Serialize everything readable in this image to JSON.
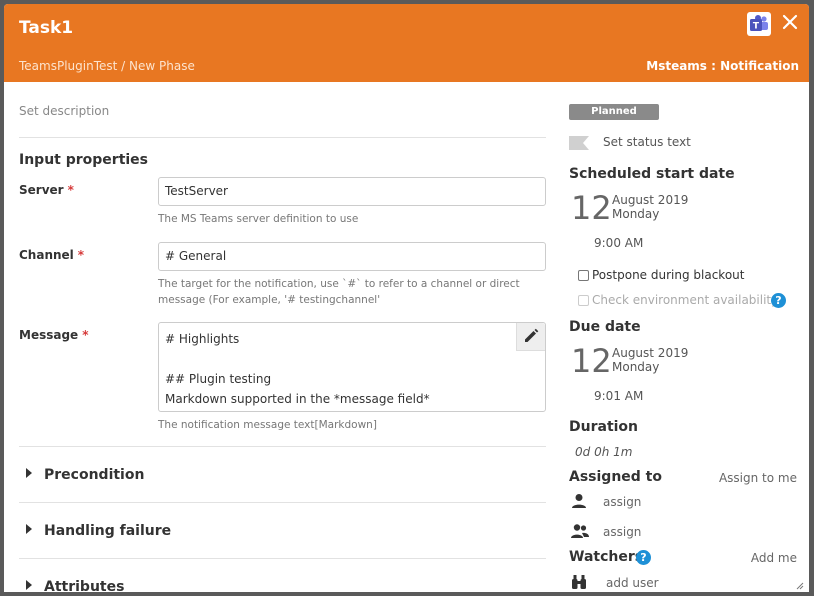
{
  "header": {
    "title": "Task1",
    "breadcrumb": "TeamsPluginTest / New Phase",
    "task_type": "Msteams : Notification",
    "color": "#e87722",
    "icons": [
      "teams-icon",
      "close-icon"
    ]
  },
  "left": {
    "description_placeholder": "Set description",
    "input_properties_title": "Input properties",
    "server": {
      "label": "Server",
      "required": "*",
      "value": "TestServer",
      "help": "The MS Teams server definition to use"
    },
    "channel": {
      "label": "Channel",
      "required": "*",
      "value": "# General",
      "help": "The target for the notification, use `#` to refer to a channel or direct message (For example, '# testingchannel'"
    },
    "message": {
      "label": "Message",
      "required": "*",
      "lines": [
        "# Highlights",
        "",
        "## Plugin testing",
        "Markdown supported in the *message field*"
      ],
      "help": "The notification message text[Markdown]"
    },
    "sections": [
      "Precondition",
      "Handling failure",
      "Attributes"
    ]
  },
  "right": {
    "status_badge": "Planned",
    "status_text_placeholder": "Set status text",
    "scheduled_start": {
      "title": "Scheduled start date",
      "day": "12",
      "month_year": "August 2019",
      "weekday": "Monday",
      "time": "9:00 AM"
    },
    "postpone_label": "Postpone during blackout",
    "check_env_label": "Check environment availability",
    "due": {
      "title": "Due date",
      "day": "12",
      "month_year": "August 2019",
      "weekday": "Monday",
      "time": "9:01 AM"
    },
    "duration": {
      "title": "Duration",
      "value": "0d 0h 1m"
    },
    "assigned": {
      "title": "Assigned to",
      "assign_to_me": "Assign to me",
      "user_placeholder": "assign",
      "team_placeholder": "assign"
    },
    "watchers": {
      "title": "Watchers",
      "add_me": "Add me",
      "add_user_placeholder": "add user"
    }
  }
}
